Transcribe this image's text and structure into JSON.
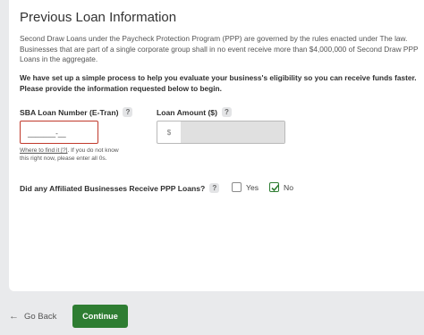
{
  "section": {
    "title": "Previous Loan Information",
    "intro": "Second Draw Loans under the Paycheck Protection Program (PPP) are governed by the rules enacted under The law. Businesses that are part of a single corporate group shall in no event receive more than $4,000,000 of Second Draw PPP Loans in the aggregate.",
    "intro_bold": "We have set up a simple process to help you evaluate your business's eligibility so you can receive funds faster. Please provide the information requested below to begin."
  },
  "fields": {
    "sba_loan_number": {
      "label": "SBA Loan Number (E-Tran)",
      "value": "_______-__",
      "help_glyph": "?",
      "helper_link": "Where to find it [?]",
      "helper_text": ". If you do not know this right now, please enter all 0s."
    },
    "loan_amount": {
      "label": "Loan Amount ($)",
      "prefix": "$",
      "value": "",
      "help_glyph": "?"
    }
  },
  "affiliated": {
    "question": "Did any Affiliated Businesses Receive PPP Loans?",
    "help_glyph": "?",
    "options": [
      {
        "label": "Yes",
        "checked": false
      },
      {
        "label": "No",
        "checked": true
      }
    ]
  },
  "footer": {
    "back_label": "Go Back",
    "back_arrow": "←",
    "continue_label": "Continue"
  },
  "colors": {
    "accent": "#2e7d32",
    "error_border": "#c0392b",
    "background": "#e9eaec"
  }
}
